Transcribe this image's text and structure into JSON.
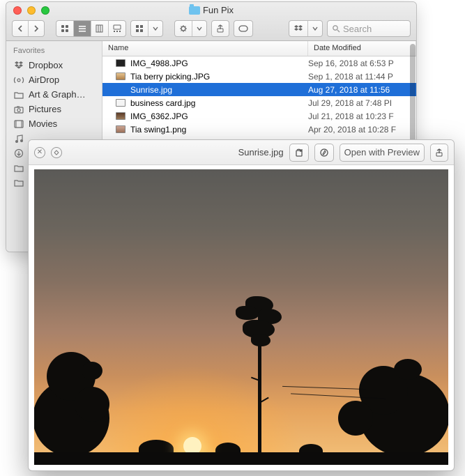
{
  "finder": {
    "title": "Fun Pix",
    "search_placeholder": "Search",
    "sidebar": {
      "heading": "Favorites",
      "items": [
        {
          "name": "dropbox",
          "label": "Dropbox"
        },
        {
          "name": "airdrop",
          "label": "AirDrop"
        },
        {
          "name": "art",
          "label": "Art & Graph…"
        },
        {
          "name": "pictures",
          "label": "Pictures"
        },
        {
          "name": "movies",
          "label": "Movies"
        }
      ]
    },
    "columns": {
      "name": "Name",
      "date": "Date Modified"
    },
    "files": [
      {
        "name": "IMG_4988.JPG",
        "date": "Sep 16, 2018 at 6:53 P",
        "thumb": "dark",
        "selected": false
      },
      {
        "name": "Tia berry picking.JPG",
        "date": "Sep 1, 2018 at 11:44 P",
        "thumb": "warm",
        "selected": false
      },
      {
        "name": "Sunrise.jpg",
        "date": "Aug 27, 2018 at 11:56",
        "thumb": "sun",
        "selected": true
      },
      {
        "name": "business card.jpg",
        "date": "Jul 29, 2018 at 7:48 PI",
        "thumb": "white",
        "selected": false
      },
      {
        "name": "IMG_6362.JPG",
        "date": "Jul 21, 2018 at 10:23 F",
        "thumb": "brown",
        "selected": false
      },
      {
        "name": "Tia swing1.png",
        "date": "Apr 20, 2018 at 10:28 F",
        "thumb": "pink",
        "selected": false
      }
    ]
  },
  "quicklook": {
    "filename": "Sunrise.jpg",
    "open_button": "Open with Preview"
  }
}
